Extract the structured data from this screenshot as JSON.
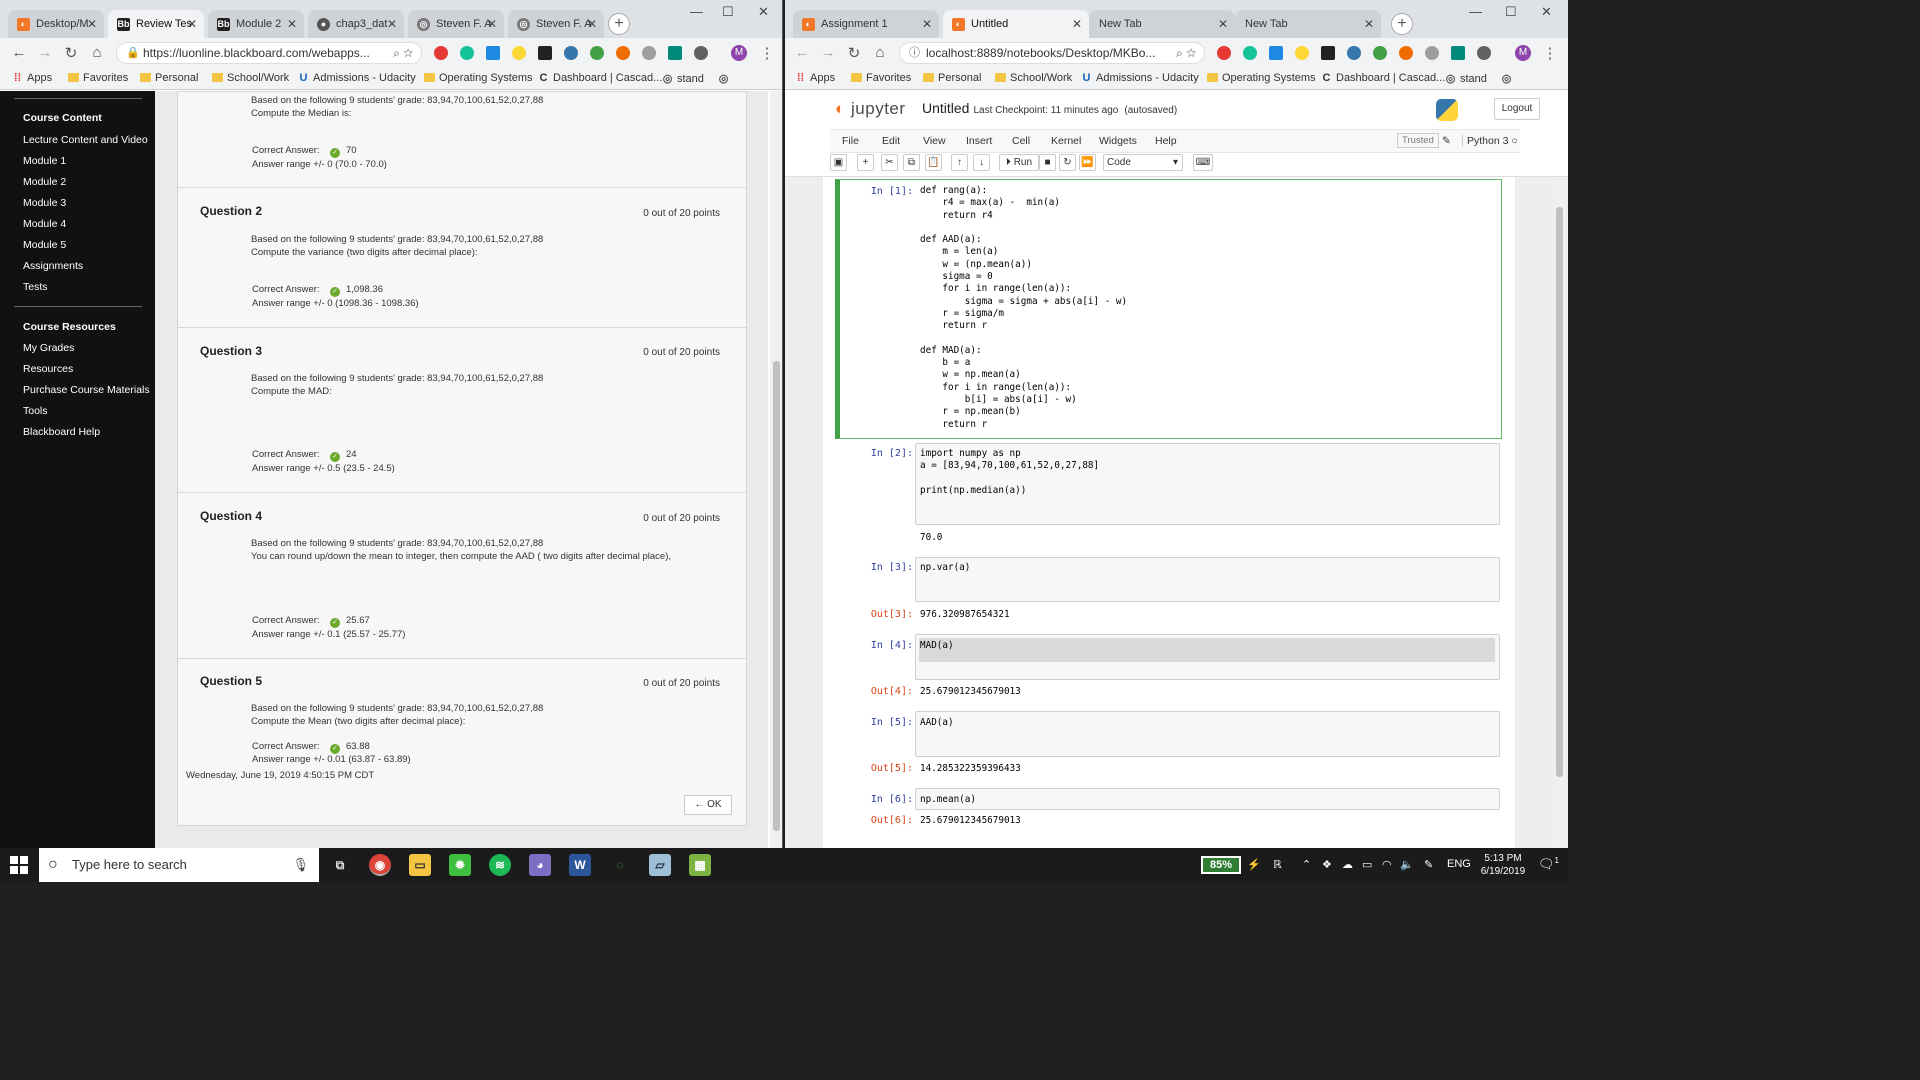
{
  "left_browser": {
    "tabs": [
      {
        "title": "Desktop/M",
        "icon": "jupyter-icon",
        "active": false
      },
      {
        "title": "Review Tes",
        "icon": "blackboard-icon",
        "active": true
      },
      {
        "title": "Module 2",
        "icon": "blackboard-icon",
        "active": false
      },
      {
        "title": "chap3_dat",
        "icon": "github-icon",
        "active": false
      },
      {
        "title": "Steven F. A",
        "icon": "globe-icon",
        "active": false
      },
      {
        "title": "Steven F. A",
        "icon": "globe-icon",
        "active": false
      }
    ],
    "url": "https://luonline.blackboard.com/webapps..."
  },
  "right_browser": {
    "tabs": [
      {
        "title": "Assignment 1",
        "active": false
      },
      {
        "title": "Untitled",
        "active": true
      },
      {
        "title": "New Tab",
        "active": false
      },
      {
        "title": "New Tab",
        "active": false
      }
    ],
    "url": "localhost:8889/notebooks/Desktop/MKBo..."
  },
  "bookmarks": {
    "apps": "Apps",
    "favorites": "Favorites",
    "personal": "Personal",
    "school_work": "School/Work",
    "admissions": "Admissions - Udacity",
    "operating_systems": "Operating Systems",
    "dashboard": "Dashboard | Cascad...",
    "stand": "stand"
  },
  "sidebar": {
    "course_content": "Course Content",
    "content_items": [
      "Lecture Content and Video",
      "Module 1",
      "Module 2",
      "Module 3",
      "Module 4",
      "Module 5",
      "Assignments",
      "Tests"
    ],
    "course_resources": "Course Resources",
    "resource_items": [
      "My Grades",
      "Resources",
      "Purchase Course Materials",
      "Tools",
      "Blackboard Help"
    ]
  },
  "questions": {
    "correct_label": "Correct Answer:",
    "q1": {
      "text1": "Based on the following 9 students' grade: 83,94,70,100,61,52,0,27,88",
      "text2": "Compute the Median is:",
      "answer": "70",
      "range": "Answer range +/- 0 (70.0 - 70.0)"
    },
    "q2": {
      "title": "Question 2",
      "points": "0 out of 20 points",
      "text1": "Based on the following 9 students' grade: 83,94,70,100,61,52,0,27,88",
      "text2": "Compute the variance (two digits after decimal place):",
      "answer": "1,098.36",
      "range": "Answer range +/- 0 (1098.36 - 1098.36)"
    },
    "q3": {
      "title": "Question 3",
      "points": "0 out of 20 points",
      "text1": "Based on the following 9 students' grade: 83,94,70,100,61,52,0,27,88",
      "text2": "Compute the MAD:",
      "answer": "24",
      "range": "Answer range +/- 0.5 (23.5 - 24.5)"
    },
    "q4": {
      "title": "Question 4",
      "points": "0 out of 20 points",
      "text1": "Based on the following 9 students' grade: 83,94,70,100,61,52,0,27,88",
      "text2": "You can round up/down the mean to integer, then compute the AAD ( two digits after decimal place),",
      "answer": "25.67",
      "range": "Answer range +/- 0.1 (25.57 - 25.77)"
    },
    "q5": {
      "title": "Question 5",
      "points": "0 out of 20 points",
      "text1": "Based on the following 9 students' grade: 83,94,70,100,61,52,0,27,88",
      "text2": "Compute the Mean (two digits after decimal place):",
      "answer": "63.88",
      "range": "Answer range +/- 0.01 (63.87 - 63.89)"
    },
    "timestamp": "Wednesday, June 19, 2019 4:50:15 PM CDT",
    "ok": "← OK"
  },
  "jupyter": {
    "logo": "jupyter",
    "notebook_title": "Untitled",
    "checkpoint": "Last Checkpoint: 11 minutes ago",
    "autosaved": "(autosaved)",
    "logout": "Logout",
    "menu": [
      "File",
      "Edit",
      "View",
      "Insert",
      "Cell",
      "Kernel",
      "Widgets",
      "Help"
    ],
    "trusted": "Trusted",
    "kernel": "Python 3",
    "run": "Run",
    "cell_type": "Code",
    "cells": [
      {
        "prompt": "In [1]:",
        "code": "def rang(a):\n    r4 = max(a) -  min(a)\n    return r4\n\ndef AAD(a):\n    m = len(a)\n    w = (np.mean(a))\n    sigma = 0\n    for i in range(len(a)):\n        sigma = sigma + abs(a[i] - w)\n    r = sigma/m\n    return r\n\ndef MAD(a):\n    b = a\n    w = np.mean(a)\n    for i in range(len(a)):\n        b[i] = abs(a[i] - w)\n    r = np.mean(b)\n    return r"
      },
      {
        "prompt": "In [2]:",
        "code": "import numpy as np\na = [83,94,70,100,61,52,0,27,88]\n\nprint(np.median(a))",
        "stdout": "70.0"
      },
      {
        "prompt": "In [3]:",
        "code": "np.var(a)",
        "out_prompt": "Out[3]:",
        "out": "976.320987654321"
      },
      {
        "prompt": "In [4]:",
        "code": "MAD(a)",
        "out_prompt": "Out[4]:",
        "out": "25.679012345679013"
      },
      {
        "prompt": "In [5]:",
        "code": "AAD(a)",
        "out_prompt": "Out[5]:",
        "out": "14.285322359396433"
      },
      {
        "prompt": "In [6]:",
        "code": "np.mean(a)",
        "out_prompt": "Out[6]:",
        "out": "25.679012345679013"
      }
    ]
  },
  "taskbar": {
    "search_placeholder": "Type here to search",
    "battery": "85%",
    "lang": "ENG",
    "time": "5:13 PM",
    "date": "6/19/2019",
    "notifications": "1"
  }
}
